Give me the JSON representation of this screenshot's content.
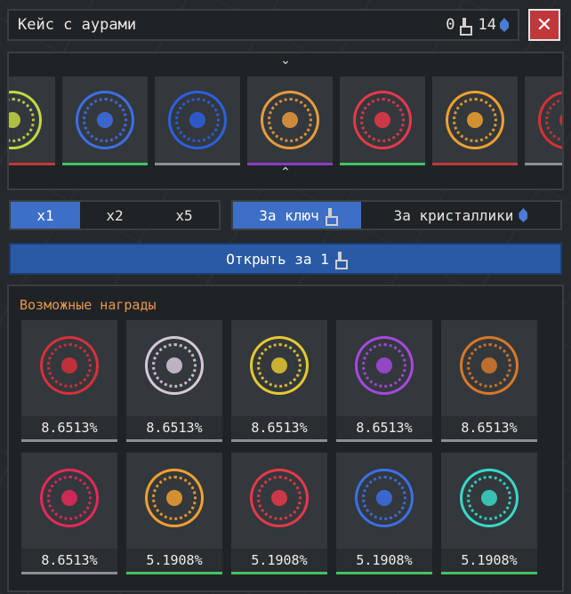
{
  "header": {
    "title": "Кейс с аурами",
    "keys_count": "0",
    "crystals_count": "14"
  },
  "close_label": "✕",
  "roulette": {
    "chevron_down": "⌄",
    "chevron_up": "⌃",
    "items": [
      {
        "color": "#c2d842",
        "rarity_color": "#c0383a",
        "icon": "aura-icon"
      },
      {
        "color": "#3d6fe6",
        "rarity_color": "#43c262",
        "icon": "water-aura-icon"
      },
      {
        "color": "#2d5fe0",
        "rarity_color": "#8a8f94",
        "icon": "water-aura-icon"
      },
      {
        "color": "#e89a3c",
        "rarity_color": "#8a3cc8",
        "icon": "ornate-aura-icon"
      },
      {
        "color": "#e8384a",
        "rarity_color": "#43c262",
        "icon": "sword-aura-icon"
      },
      {
        "color": "#f0a030",
        "rarity_color": "#c0383a",
        "icon": "sun-aura-icon"
      },
      {
        "color": "#d83030",
        "rarity_color": "#8a8f94",
        "icon": "aura-icon"
      }
    ]
  },
  "multipliers": [
    "x1",
    "x2",
    "x5"
  ],
  "payment": {
    "key_label": "За ключ",
    "crystal_label": "За кристаллики"
  },
  "open_button": {
    "label": "Открыть за 1"
  },
  "rewards": {
    "title": "Возможные награды",
    "items": [
      {
        "pct": "8.6513%",
        "color": "#d8303a",
        "rarity_color": "#8a8f94",
        "icon": "spider-aura-icon"
      },
      {
        "pct": "8.6513%",
        "color": "#d6c8d8",
        "rarity_color": "#8a8f94",
        "icon": "skull-aura-icon"
      },
      {
        "pct": "8.6513%",
        "color": "#e8c830",
        "rarity_color": "#8a8f94",
        "icon": "star-aura-icon"
      },
      {
        "pct": "8.6513%",
        "color": "#a648e0",
        "rarity_color": "#8a8f94",
        "icon": "rune-aura-icon"
      },
      {
        "pct": "8.6513%",
        "color": "#d87828",
        "rarity_color": "#8a8f94",
        "icon": "rune-aura-icon"
      },
      {
        "pct": "8.6513%",
        "color": "#e8285a",
        "rarity_color": "#8a8f94",
        "icon": "claw-aura-icon"
      },
      {
        "pct": "5.1908%",
        "color": "#f0a030",
        "rarity_color": "#43c262",
        "icon": "shard-aura-icon"
      },
      {
        "pct": "5.1908%",
        "color": "#e8384a",
        "rarity_color": "#43c262",
        "icon": "sword-aura-icon"
      },
      {
        "pct": "5.1908%",
        "color": "#3d6fe6",
        "rarity_color": "#43c262",
        "icon": "water-aura-icon"
      },
      {
        "pct": "5.1908%",
        "color": "#38d8c8",
        "rarity_color": "#43c262",
        "icon": "sparkle-aura-icon"
      }
    ]
  }
}
